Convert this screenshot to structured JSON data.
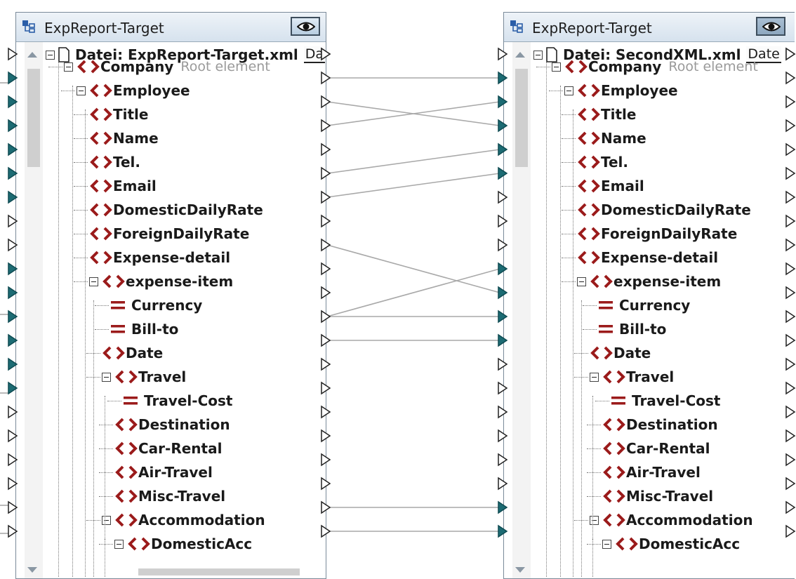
{
  "colors": {
    "element": "#9b1b1b",
    "connector_filled": "#1c6b73",
    "line": "#a9a9a9"
  },
  "left": {
    "title": "ExpReport-Target",
    "file_label": "Datei: ExpReport-Target.xml",
    "file_button": "Da",
    "items": [
      {
        "label": "Company",
        "hint": "Root element",
        "type": "element",
        "expander": true
      },
      {
        "label": "Employee",
        "type": "element",
        "expander": true
      },
      {
        "label": "Title",
        "type": "element"
      },
      {
        "label": "Name",
        "type": "element"
      },
      {
        "label": "Tel.",
        "type": "element"
      },
      {
        "label": "Email",
        "type": "element"
      },
      {
        "label": "DomesticDailyRate",
        "type": "element"
      },
      {
        "label": "ForeignDailyRate",
        "type": "element"
      },
      {
        "label": "Expense-detail",
        "type": "element"
      },
      {
        "label": "expense-item",
        "type": "element",
        "expander": true
      },
      {
        "label": "Currency",
        "type": "attribute"
      },
      {
        "label": "Bill-to",
        "type": "attribute"
      },
      {
        "label": "Date",
        "type": "element"
      },
      {
        "label": "Travel",
        "type": "element",
        "expander": true
      },
      {
        "label": "Travel-Cost",
        "type": "attribute"
      },
      {
        "label": "Destination",
        "type": "element"
      },
      {
        "label": "Car-Rental",
        "type": "element"
      },
      {
        "label": "Air-Travel",
        "type": "element"
      },
      {
        "label": "Misc-Travel",
        "type": "element"
      },
      {
        "label": "Accommodation",
        "type": "element",
        "expander": true
      },
      {
        "label": "DomesticAcc",
        "type": "element",
        "expander": true
      }
    ]
  },
  "right": {
    "title": "ExpReport-Target",
    "file_label": "Datei: SecondXML.xml",
    "file_button": "Date",
    "items": [
      {
        "label": "Company",
        "hint": "Root element",
        "type": "element",
        "expander": true
      },
      {
        "label": "Employee",
        "type": "element",
        "expander": true
      },
      {
        "label": "Title",
        "type": "element"
      },
      {
        "label": "Name",
        "type": "element"
      },
      {
        "label": "Tel.",
        "type": "element"
      },
      {
        "label": "Email",
        "type": "element"
      },
      {
        "label": "DomesticDailyRate",
        "type": "element"
      },
      {
        "label": "ForeignDailyRate",
        "type": "element"
      },
      {
        "label": "Expense-detail",
        "type": "element"
      },
      {
        "label": "expense-item",
        "type": "element",
        "expander": true
      },
      {
        "label": "Currency",
        "type": "attribute"
      },
      {
        "label": "Bill-to",
        "type": "attribute"
      },
      {
        "label": "Date",
        "type": "element"
      },
      {
        "label": "Travel",
        "type": "element",
        "expander": true
      },
      {
        "label": "Travel-Cost",
        "type": "attribute"
      },
      {
        "label": "Destination",
        "type": "element"
      },
      {
        "label": "Car-Rental",
        "type": "element"
      },
      {
        "label": "Air-Travel",
        "type": "element"
      },
      {
        "label": "Misc-Travel",
        "type": "element"
      },
      {
        "label": "Accommodation",
        "type": "element",
        "expander": true
      },
      {
        "label": "DomesticAcc",
        "type": "element",
        "expander": true
      }
    ]
  },
  "mappings": [
    {
      "from": "Employee",
      "to": "Employee"
    },
    {
      "from": "Title",
      "to": "Name"
    },
    {
      "from": "Name",
      "to": "Title"
    },
    {
      "from": "Email",
      "to": "Tel."
    },
    {
      "from": "DomesticDailyRate",
      "to": "Email"
    },
    {
      "from": "Expense-detail",
      "to": "Currency"
    },
    {
      "from": "Bill-to",
      "to": "expense-item"
    },
    {
      "from": "Bill-to",
      "to": "Bill-to"
    },
    {
      "from": "Date",
      "to": "Date"
    },
    {
      "from": "Accommodation",
      "to": "Accommodation"
    },
    {
      "from": "DomesticAcc",
      "to": "DomesticAcc"
    }
  ]
}
